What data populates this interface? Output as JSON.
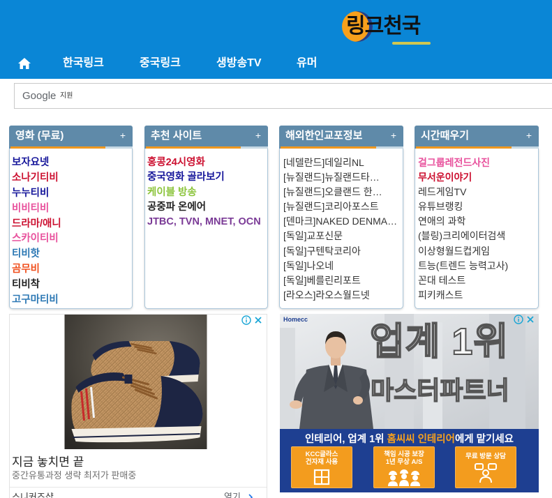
{
  "header": {
    "logo_text": "링크천국",
    "home_icon": "home-icon"
  },
  "nav": {
    "items": [
      {
        "label": "한국링크"
      },
      {
        "label": "중국링크"
      },
      {
        "label": "생방송TV"
      },
      {
        "label": "유머"
      }
    ]
  },
  "search": {
    "brand": "Google",
    "label": "지원"
  },
  "boxes": [
    {
      "title": "영화 (무료)",
      "toggle": "+",
      "items": [
        {
          "label": "보자요넷",
          "color": "#15159a"
        },
        {
          "label": "소나기티비",
          "color": "#cc1030"
        },
        {
          "label": "누누티비",
          "color": "#15159a"
        },
        {
          "label": "비비티비",
          "color": "#e8509c"
        },
        {
          "label": "드라마/애니",
          "color": "#cc1030"
        },
        {
          "label": "스카이티비",
          "color": "#e8509c"
        },
        {
          "label": "티비핫",
          "color": "#2c78b4"
        },
        {
          "label": "곰무비",
          "color": "#f0501e"
        },
        {
          "label": "티비착",
          "color": "#222222"
        },
        {
          "label": "고구마티비",
          "color": "#2c78b4"
        }
      ]
    },
    {
      "title": "추천 사이트",
      "toggle": "+",
      "items": [
        {
          "label": "홍콩24시영화",
          "color": "#cc1030"
        },
        {
          "label": "중국영화 골라보기",
          "color": "#15159a"
        },
        {
          "label": "케이블 방송",
          "color": "#8cc43c"
        },
        {
          "label": "공중파 온에어",
          "color": "#222222"
        },
        {
          "label": "JTBC, TVN, MNET, OCN",
          "color": "#7a3a96"
        }
      ]
    },
    {
      "title": "해외한인교포정보",
      "toggle": "+",
      "items": [
        {
          "label": "[네델란드]데일리NL"
        },
        {
          "label": "[뉴질랜드]뉴질랜드타…"
        },
        {
          "label": "[뉴질랜드]오클랜드 한…"
        },
        {
          "label": "[뉴질랜드]코리아포스트"
        },
        {
          "label": "[덴마크]NAKED DENMA…"
        },
        {
          "label": "[독일]교포신문"
        },
        {
          "label": "[독일]구텐탁코리아"
        },
        {
          "label": "[독일]나오네"
        },
        {
          "label": "[독일]베를린리포트"
        },
        {
          "label": "[라오스]라오스월드넷"
        }
      ]
    },
    {
      "title": "시간때우기",
      "toggle": "+",
      "items": [
        {
          "label": "걸그룹레전드사진",
          "color": "#e8509c"
        },
        {
          "label": "무서운이야기",
          "color": "#cc1030"
        },
        {
          "label": "레드게임TV"
        },
        {
          "label": "유튜브랭킹"
        },
        {
          "label": "연애의 과학"
        },
        {
          "label": "(블링)크리에이터검색"
        },
        {
          "label": "이상형월드컵게임"
        },
        {
          "label": "트능(트렌드 능력고사)"
        },
        {
          "label": "꼰대 테스트"
        },
        {
          "label": "피키캐스트"
        }
      ]
    }
  ],
  "ads": {
    "left": {
      "headline": "지금 놓치면 끝",
      "description": "중간유통과정 생략 최저가 판매중",
      "advertiser": "스니커즈샵",
      "cta": "열기",
      "image_icon": "sneakers-image",
      "info_icon": "info-icon",
      "close_icon": "close-icon"
    },
    "right": {
      "brand": "Homecc",
      "big_line1": "업계 1위",
      "big_line2": "마스터파트너",
      "headline_pre": "인테리어, 업계 1위 ",
      "headline_brand": "홈씨씨 인테리어",
      "headline_post": "에게 맡기세요",
      "features": [
        {
          "line1": "KCC글라스",
          "line2": "건자재 사용",
          "icon": "window-icon"
        },
        {
          "line1": "책임 시공 보장",
          "line2": "1년 무상 A/S",
          "icon": "workers-icon"
        },
        {
          "line1": "무료 방문 상담",
          "icon": "consult-chat-icon"
        }
      ],
      "info_icon": "info-icon",
      "close_icon": "close-icon"
    }
  },
  "colors": {
    "header_blue": "#0a86d6",
    "box_header": "#5f8aa9",
    "accent_orange": "#f39a1f",
    "ad_band": "#1e3f91",
    "ad_choices": "#1aa6d6"
  }
}
